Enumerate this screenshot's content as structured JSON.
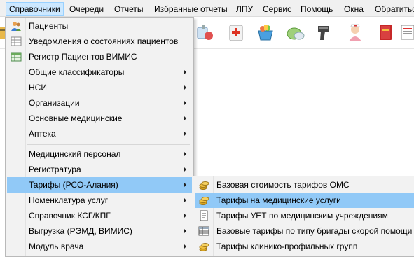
{
  "menubar": {
    "items": [
      {
        "label": "Справочники",
        "active": true
      },
      {
        "label": "Очереди"
      },
      {
        "label": "Отчеты"
      },
      {
        "label": "Избранные отчеты"
      },
      {
        "label": "ЛПУ"
      },
      {
        "label": "Сервис"
      },
      {
        "label": "Помощь"
      },
      {
        "label": "Окна"
      },
      {
        "label": "Обратиться"
      }
    ]
  },
  "toolbar": {
    "icons": [
      "syringe-vial-icon",
      "first-aid-kit-icon",
      "pharmacy-basket-icon",
      "pills-icon",
      "barcode-scanner-icon",
      "nurse-icon",
      "red-book-icon",
      "report-document-icon"
    ]
  },
  "menu": {
    "items": [
      {
        "label": "Пациенты",
        "icon": "patients-icon",
        "submenu": false
      },
      {
        "label": "Уведомления о состояниях пациентов",
        "icon": "notifications-grid-icon",
        "submenu": false
      },
      {
        "label": "Регистр Пациентов ВИМИС",
        "icon": "register-table-icon",
        "submenu": false
      },
      {
        "label": "Общие классификаторы",
        "submenu": true
      },
      {
        "label": "НСИ",
        "submenu": true
      },
      {
        "label": "Организации",
        "submenu": true
      },
      {
        "label": "Основные медицинские",
        "submenu": true
      },
      {
        "label": "Аптека",
        "submenu": true
      },
      {
        "label": "Медицинский персонал",
        "submenu": true
      },
      {
        "label": "Регистратура",
        "submenu": true
      },
      {
        "label": "Тарифы (РСО-Алания)",
        "submenu": true,
        "highlighted": true
      },
      {
        "label": "Номенклатура услуг",
        "submenu": true
      },
      {
        "label": "Справочник КСГ/КПГ",
        "submenu": true
      },
      {
        "label": "Выгрузка (РЭМД, ВИМИС)",
        "submenu": true
      },
      {
        "label": "Модуль врача",
        "submenu": true
      }
    ]
  },
  "submenu": {
    "items": [
      {
        "label": "Базовая стоимость тарифов ОМС",
        "icon": "coins-icon"
      },
      {
        "label": "Тарифы на медицинские услуги",
        "icon": "coins-icon",
        "highlighted": true
      },
      {
        "label": "Тарифы УЕТ по медицинским учреждениям",
        "icon": "document-icon"
      },
      {
        "label": "Базовые тарифы по типу бригады скорой помощи",
        "icon": "table-icon"
      },
      {
        "label": "Тарифы клинико-профильных групп",
        "icon": "coins-icon"
      }
    ]
  },
  "colors": {
    "menu_bg": "#f2f2f2",
    "highlight": "#91c9f7",
    "menubar_active": "#cce8ff"
  }
}
